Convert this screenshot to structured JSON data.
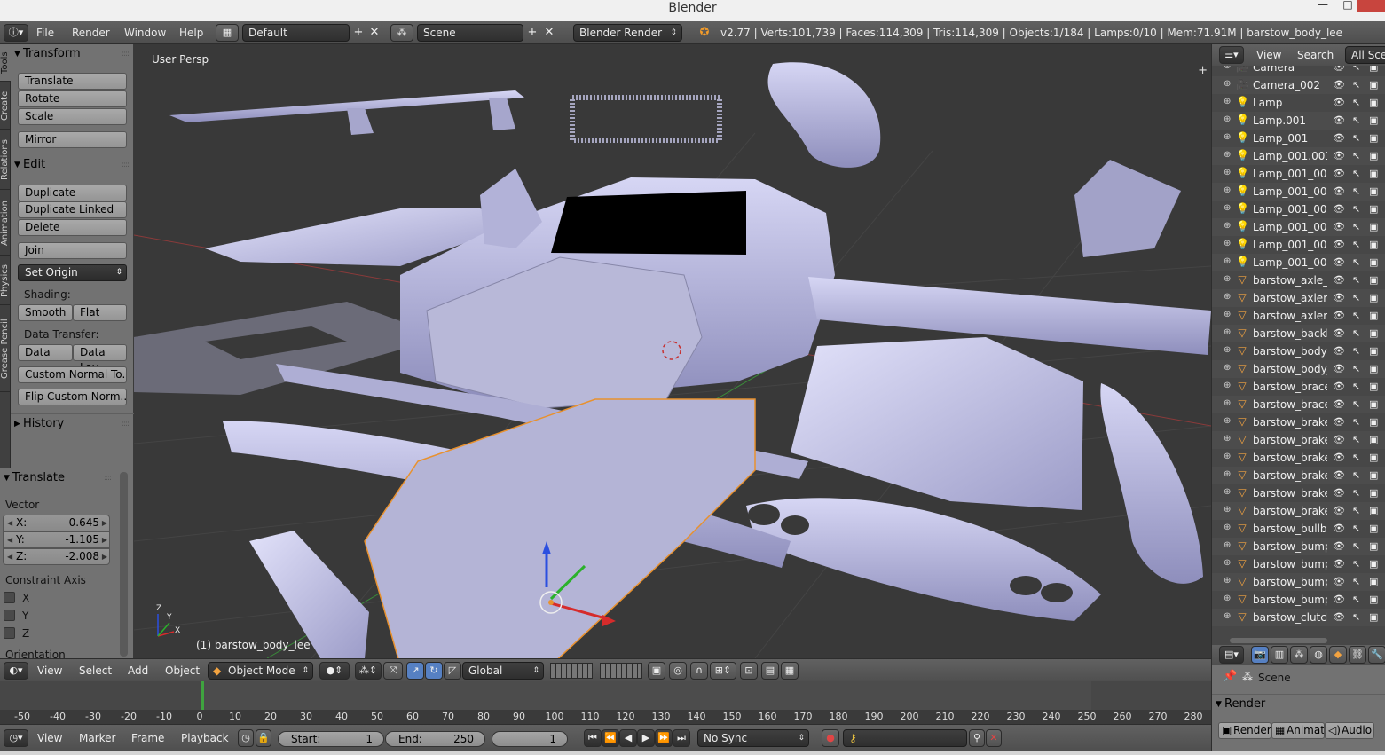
{
  "window": {
    "title": "Blender",
    "minimize": "—",
    "maximize": "□"
  },
  "info_header": {
    "menus": [
      "File",
      "Render",
      "Window",
      "Help"
    ],
    "screen_layout": "Default",
    "scene": "Scene",
    "render_engine": "Blender Render",
    "stats": "v2.77 | Verts:101,739 | Faces:114,309 | Tris:114,309 | Objects:1/184 | Lamps:0/10 | Mem:71.91M | barstow_body_lee"
  },
  "shelf_tabs": [
    "Tools",
    "Create",
    "Relations",
    "Animation",
    "Physics",
    "Grease Pencil"
  ],
  "toolshelf": {
    "transform": {
      "title": "Transform",
      "buttons": [
        "Translate",
        "Rotate",
        "Scale",
        "Mirror"
      ]
    },
    "edit": {
      "title": "Edit",
      "buttons": [
        "Duplicate",
        "Duplicate Linked",
        "Delete",
        "Join",
        "Set Origin"
      ]
    },
    "shading_label": "Shading:",
    "shading": [
      "Smooth",
      "Flat"
    ],
    "data_transfer_label": "Data Transfer:",
    "data_transfer": [
      "Data",
      "Data Lay"
    ],
    "custom_normal": "Custom Normal To...",
    "flip_custom": "Flip Custom Norm...",
    "history": "History"
  },
  "operator": {
    "title": "Translate",
    "vector_label": "Vector",
    "x_label": "X:",
    "x": "-0.645",
    "y_label": "Y:",
    "y": "-1.105",
    "z_label": "Z:",
    "z": "-2.008",
    "constraint_label": "Constraint Axis",
    "axes": [
      "X",
      "Y",
      "Z"
    ],
    "orientation_label": "Orientation"
  },
  "viewport": {
    "view_name": "User Persp",
    "active_object": "(1) barstow_body_lee",
    "axis_x": "X",
    "axis_y": "Y",
    "axis_z": "Z"
  },
  "view3d_header": {
    "menus": [
      "View",
      "Select",
      "Add",
      "Object"
    ],
    "mode": "Object Mode",
    "orientation": "Global"
  },
  "timeline": {
    "ticks": [
      "-50",
      "-40",
      "-30",
      "-20",
      "-10",
      "0",
      "10",
      "20",
      "30",
      "40",
      "50",
      "60",
      "70",
      "80",
      "90",
      "100",
      "110",
      "120",
      "130",
      "140",
      "150",
      "160",
      "170",
      "180",
      "190",
      "200",
      "210",
      "220",
      "230",
      "240",
      "250",
      "260",
      "270",
      "280"
    ],
    "menus": [
      "View",
      "Marker",
      "Frame",
      "Playback"
    ],
    "start_label": "Start:",
    "start": "1",
    "end_label": "End:",
    "end": "250",
    "current": "1",
    "sync": "No Sync"
  },
  "outliner": {
    "menus": [
      "View",
      "Search"
    ],
    "filter": "All Sce",
    "items": [
      {
        "name": "Camera",
        "type": "camera"
      },
      {
        "name": "Camera_002",
        "type": "camera"
      },
      {
        "name": "Lamp",
        "type": "lamp"
      },
      {
        "name": "Lamp.001",
        "type": "lamp"
      },
      {
        "name": "Lamp_001",
        "type": "lamp"
      },
      {
        "name": "Lamp_001.001",
        "type": "lamp"
      },
      {
        "name": "Lamp_001_001",
        "type": "lamp"
      },
      {
        "name": "Lamp_001_001",
        "type": "lamp"
      },
      {
        "name": "Lamp_001_001",
        "type": "lamp"
      },
      {
        "name": "Lamp_001_001",
        "type": "lamp"
      },
      {
        "name": "Lamp_001_001",
        "type": "lamp"
      },
      {
        "name": "Lamp_001_001",
        "type": "lamp"
      },
      {
        "name": "barstow_axle_F",
        "type": "mesh"
      },
      {
        "name": "barstow_axlem",
        "type": "mesh"
      },
      {
        "name": "barstow_axlem",
        "type": "mesh"
      },
      {
        "name": "barstow_backli",
        "type": "mesh"
      },
      {
        "name": "barstow_body",
        "type": "mesh"
      },
      {
        "name": "barstow_body_",
        "type": "mesh"
      },
      {
        "name": "barstow_brace",
        "type": "mesh"
      },
      {
        "name": "barstow_brace",
        "type": "mesh"
      },
      {
        "name": "barstow_brake",
        "type": "mesh"
      },
      {
        "name": "barstow_brake",
        "type": "mesh"
      },
      {
        "name": "barstow_brake",
        "type": "mesh"
      },
      {
        "name": "barstow_brake",
        "type": "mesh"
      },
      {
        "name": "barstow_brake",
        "type": "mesh"
      },
      {
        "name": "barstow_brake",
        "type": "mesh"
      },
      {
        "name": "barstow_bullba",
        "type": "mesh"
      },
      {
        "name": "barstow_bump",
        "type": "mesh"
      },
      {
        "name": "barstow_bump",
        "type": "mesh"
      },
      {
        "name": "barstow_bump",
        "type": "mesh"
      },
      {
        "name": "barstow_bump",
        "type": "mesh"
      },
      {
        "name": "barstow_clutch",
        "type": "mesh"
      }
    ]
  },
  "properties": {
    "scene": "Scene",
    "render_panel": "Render",
    "buttons": [
      "Render",
      "Animati",
      "Audio"
    ]
  }
}
